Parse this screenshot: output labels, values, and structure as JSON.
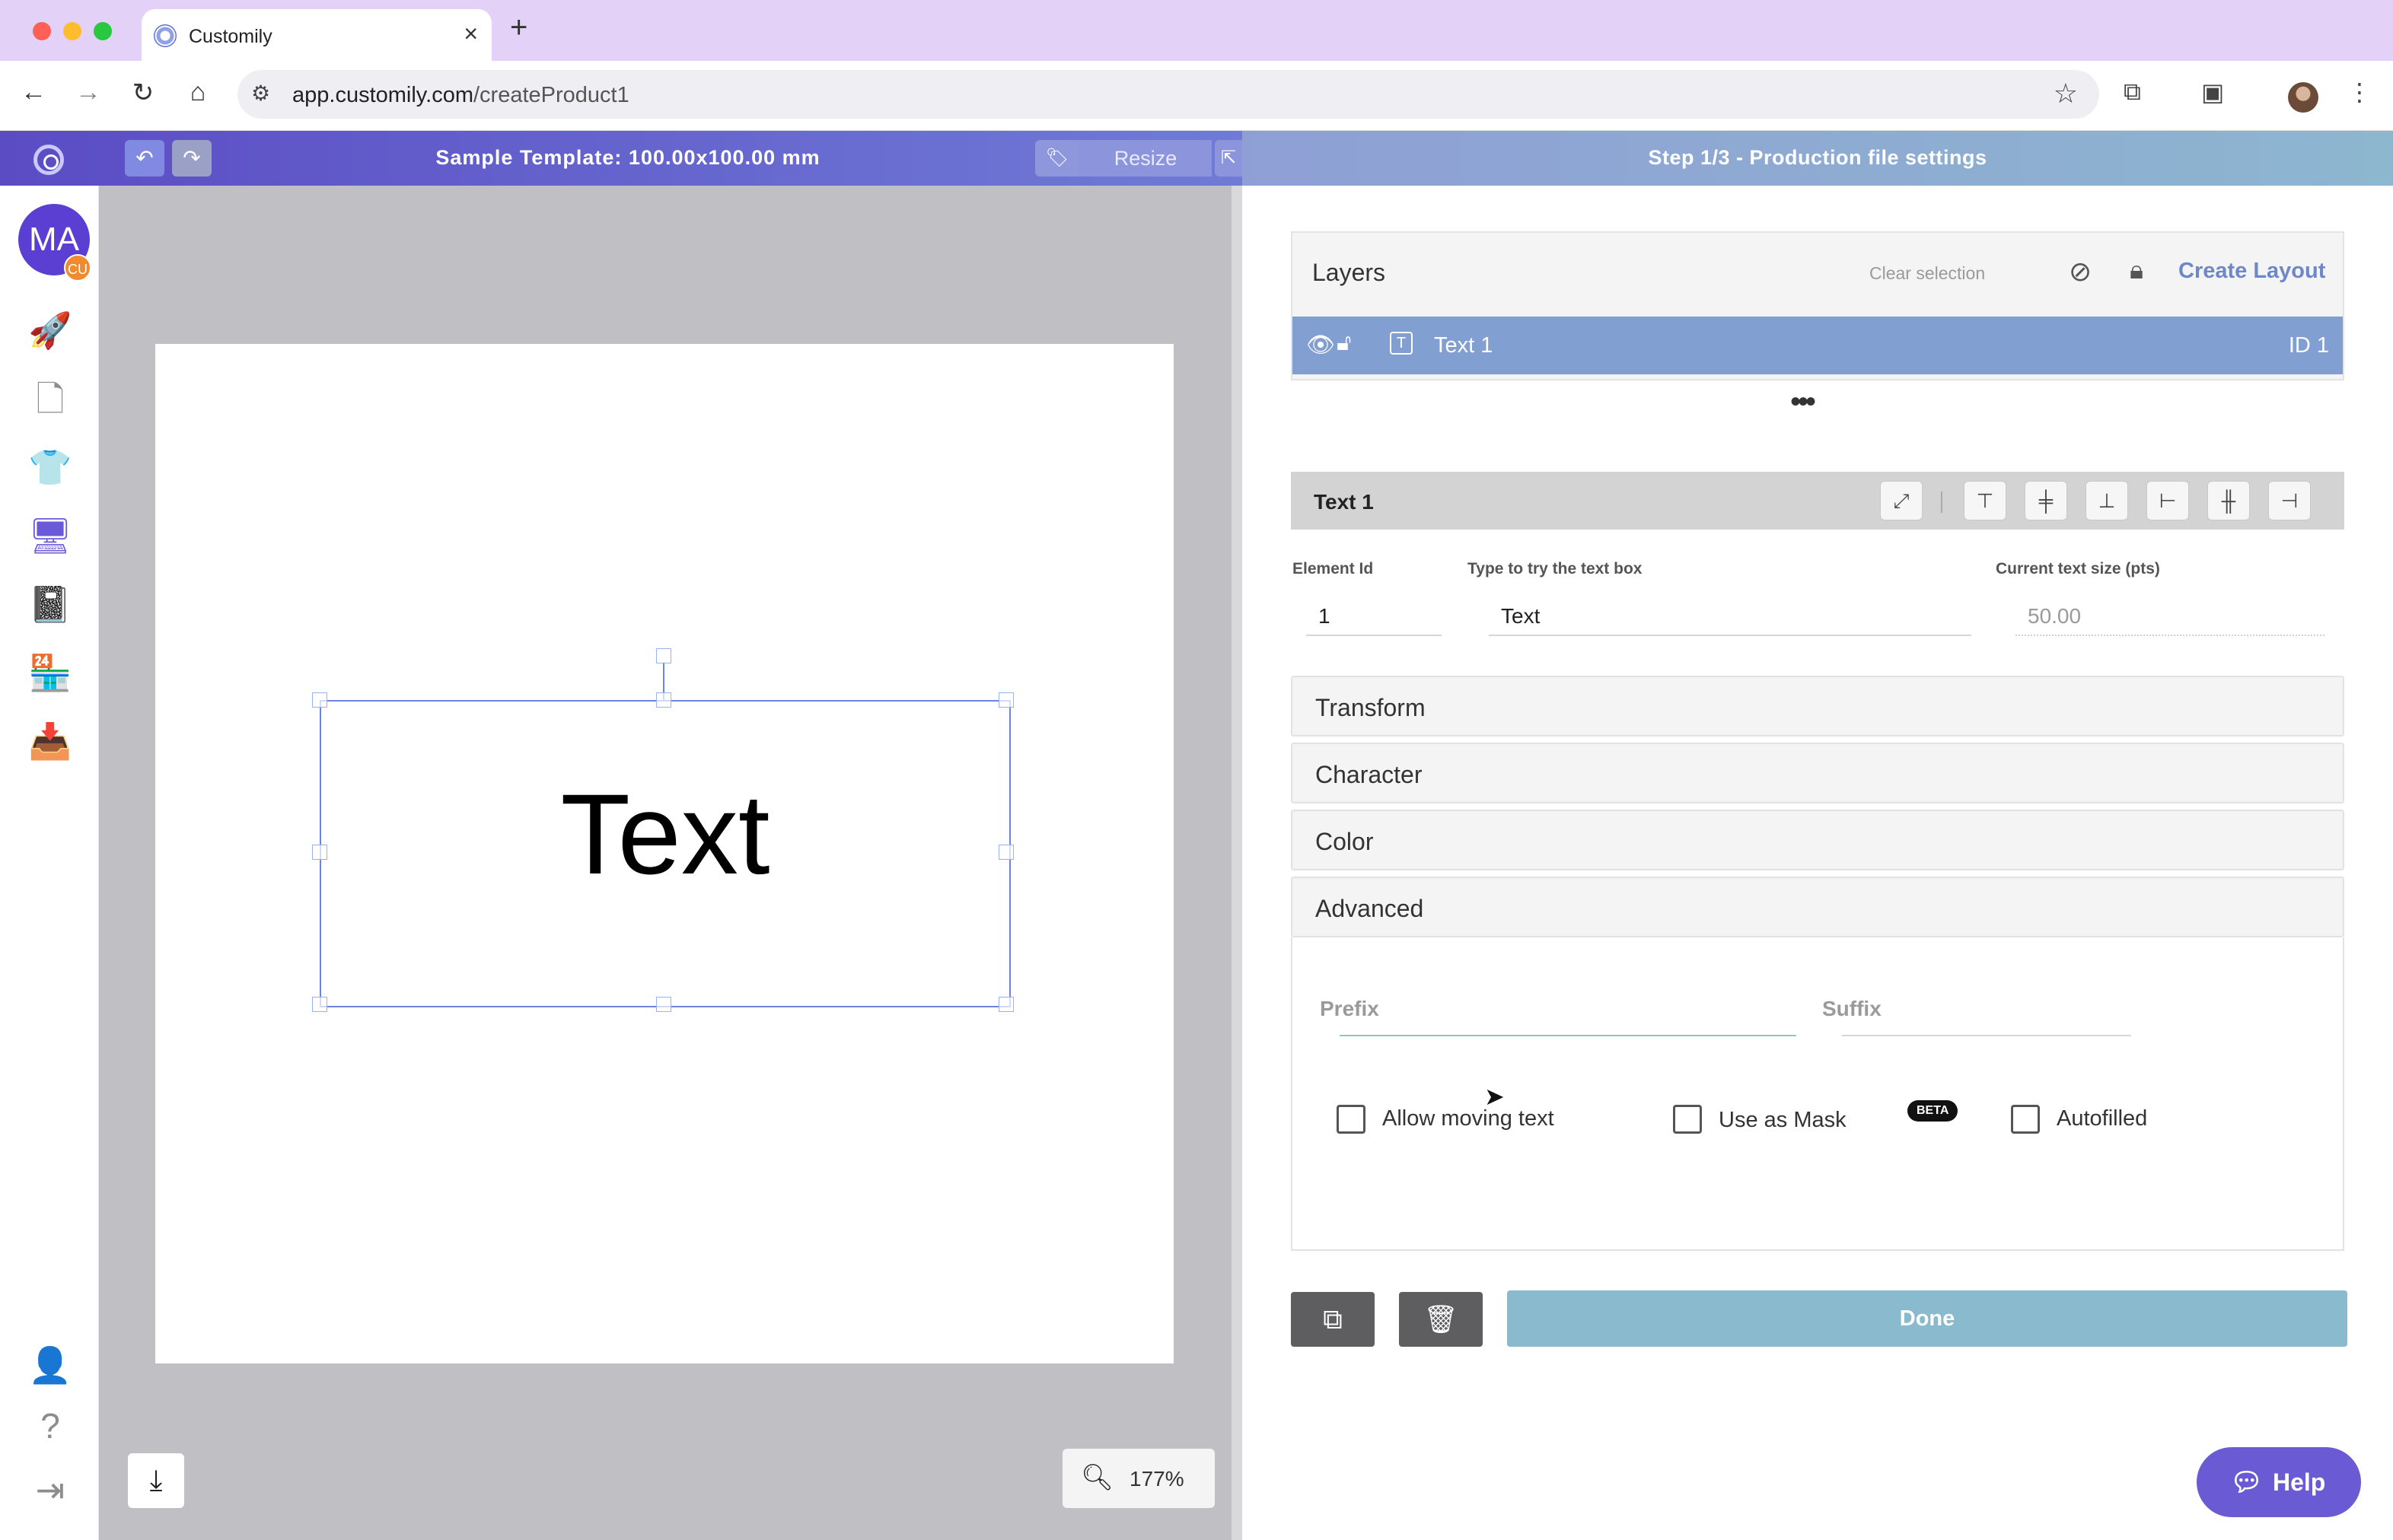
{
  "browser": {
    "tab_title": "Customily",
    "url_host": "app.customily.com",
    "url_path": "/createProduct1"
  },
  "appbar": {
    "template_title": "Sample Template: 100.00x100.00 mm",
    "resize_label": "Resize",
    "step_title": "Step 1/3 - Production file settings"
  },
  "sidebar": {
    "avatar_initials": "MA",
    "avatar_badge": "CU",
    "items": [
      {
        "name": "rocket-icon"
      },
      {
        "name": "document-icon"
      },
      {
        "name": "tshirt-icon"
      },
      {
        "name": "design-monitor-icon",
        "active": true
      },
      {
        "name": "book-icon"
      },
      {
        "name": "store-icon"
      },
      {
        "name": "inbox-icon"
      }
    ],
    "bottom_items": [
      {
        "name": "user-settings-icon"
      },
      {
        "name": "help-circle-icon"
      },
      {
        "name": "logout-icon"
      }
    ]
  },
  "canvas": {
    "text_content": "Text",
    "zoom": "177%"
  },
  "layers": {
    "title": "Layers",
    "clear_selection": "Clear selection",
    "create_layout": "Create Layout",
    "rows": [
      {
        "name": "Text 1",
        "id": "ID 1"
      }
    ]
  },
  "element": {
    "title": "Text 1",
    "fields": {
      "element_id_label": "Element Id",
      "element_id_value": "1",
      "try_text_label": "Type to try the text box",
      "try_text_value": "Text",
      "text_size_label": "Current text size (pts)",
      "text_size_value": "50.00"
    }
  },
  "sections": {
    "transform": "Transform",
    "character": "Character",
    "color": "Color",
    "advanced": "Advanced"
  },
  "advanced": {
    "prefix_label": "Prefix",
    "suffix_label": "Suffix",
    "allow_moving_text": "Allow moving text",
    "use_as_mask": "Use as Mask",
    "beta": "BETA",
    "autofilled": "Autofilled"
  },
  "actions": {
    "done": "Done",
    "help": "Help"
  },
  "colors": {
    "brand": "#5b4cc4",
    "layer_selected": "#829fd1",
    "done_button": "#89bacd",
    "help_button": "#6a5ad4"
  }
}
